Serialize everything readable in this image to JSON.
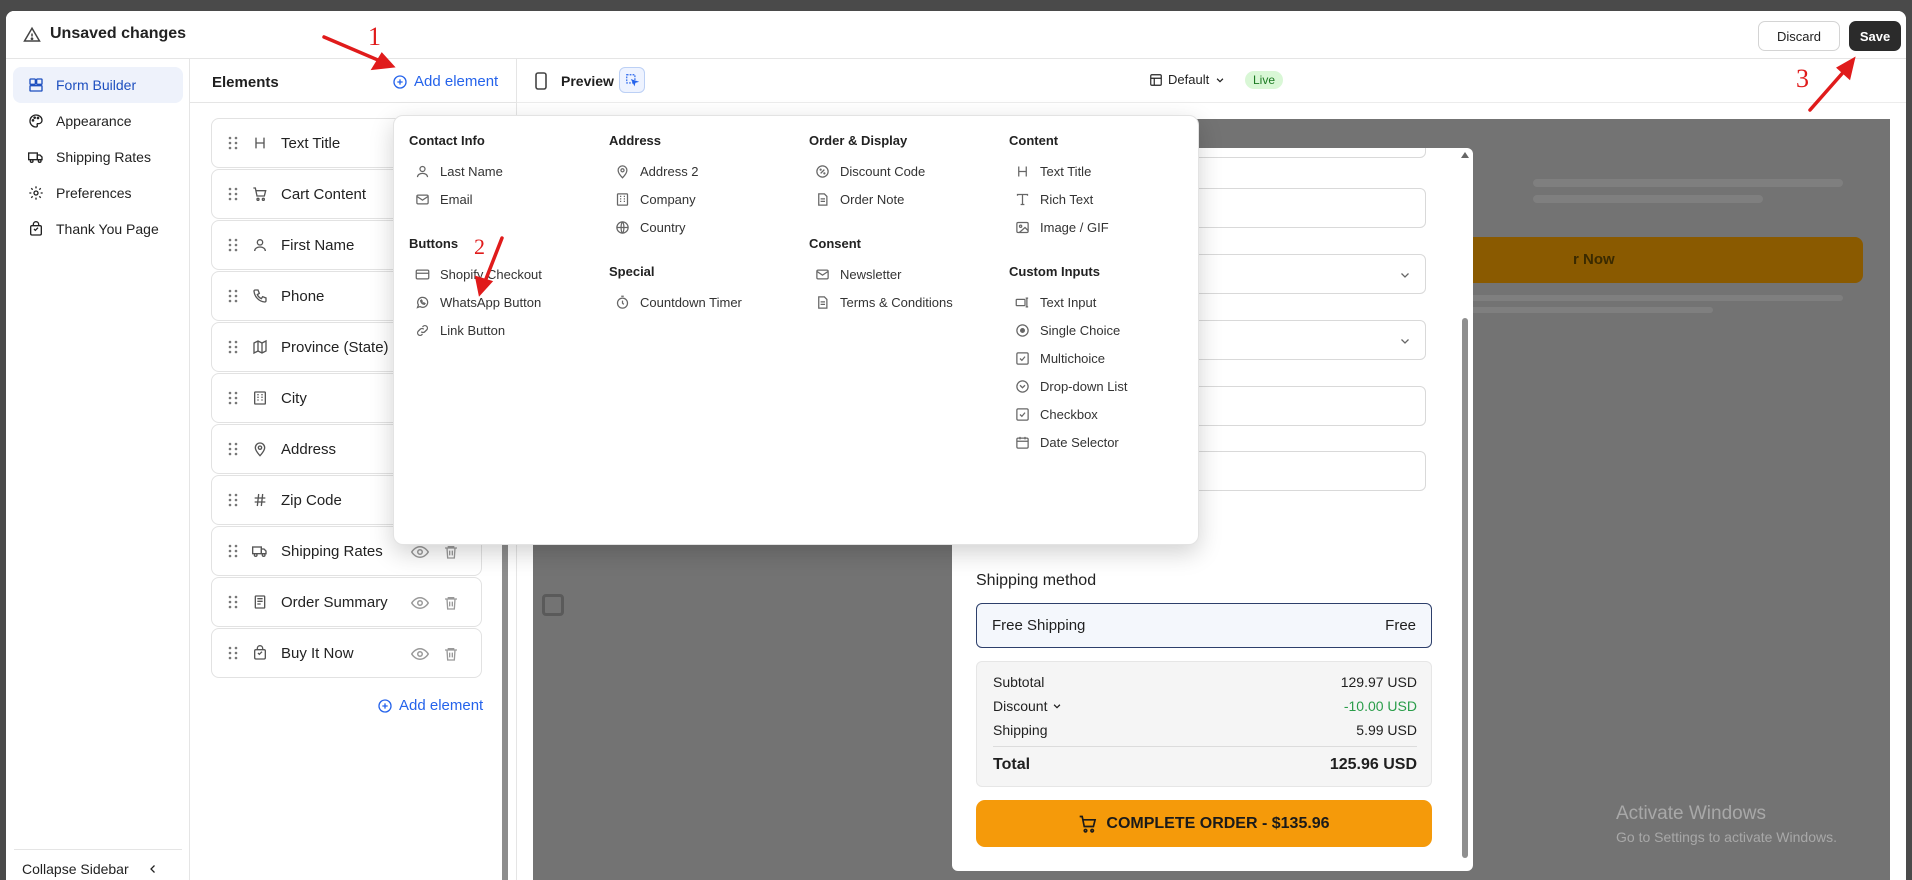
{
  "topbar": {
    "title": "Unsaved changes",
    "discard_label": "Discard",
    "save_label": "Save"
  },
  "sidebar": {
    "items": [
      {
        "label": "Form Builder",
        "icon": "layout-icon",
        "active": true
      },
      {
        "label": "Appearance",
        "icon": "palette-icon",
        "active": false
      },
      {
        "label": "Shipping Rates",
        "icon": "truck-icon",
        "active": false
      },
      {
        "label": "Preferences",
        "icon": "gear-icon",
        "active": false
      },
      {
        "label": "Thank You Page",
        "icon": "bag-icon",
        "active": false
      }
    ],
    "collapse_label": "Collapse Sidebar"
  },
  "elements": {
    "title": "Elements",
    "add_label": "Add element",
    "rows": [
      {
        "label": "Text Title",
        "icon": "heading-icon"
      },
      {
        "label": "Cart Content",
        "icon": "cart-icon"
      },
      {
        "label": "First Name",
        "icon": "user-icon"
      },
      {
        "label": "Phone",
        "icon": "phone-icon"
      },
      {
        "label": "Province (State)",
        "icon": "map-icon"
      },
      {
        "label": "City",
        "icon": "building-icon"
      },
      {
        "label": "Address",
        "icon": "pin-icon"
      },
      {
        "label": "Zip Code",
        "icon": "hash-icon"
      },
      {
        "label": "Shipping Rates",
        "icon": "truck-icon"
      },
      {
        "label": "Order Summary",
        "icon": "receipt-icon"
      },
      {
        "label": "Buy It Now",
        "icon": "bag-icon"
      }
    ],
    "add_bottom_label": "Add element"
  },
  "preview": {
    "label": "Preview",
    "variant": "Default",
    "status": "Live",
    "ghost_button": "r Now"
  },
  "checkout": {
    "shipping_title": "Shipping method",
    "shipping_option": {
      "name": "Free Shipping",
      "price": "Free"
    },
    "summary": {
      "subtotal_label": "Subtotal",
      "subtotal_value": "129.97 USD",
      "discount_label": "Discount",
      "discount_value": "-10.00 USD",
      "shipping_label": "Shipping",
      "shipping_value": "5.99 USD",
      "total_label": "Total",
      "total_value": "125.96 USD"
    },
    "complete_label": "COMPLETE ORDER - $135.96"
  },
  "menu": {
    "columns": [
      {
        "groups": [
          {
            "title": "Contact Info",
            "items": [
              {
                "label": "Last Name",
                "icon": "user-icon"
              },
              {
                "label": "Email",
                "icon": "mail-icon"
              }
            ]
          },
          {
            "title": "Buttons",
            "items": [
              {
                "label": "Shopify Checkout",
                "icon": "card-icon"
              },
              {
                "label": "WhatsApp Button",
                "icon": "whatsapp-icon"
              },
              {
                "label": "Link Button",
                "icon": "link-icon"
              }
            ]
          }
        ]
      },
      {
        "groups": [
          {
            "title": "Address",
            "items": [
              {
                "label": "Address 2",
                "icon": "pin-icon"
              },
              {
                "label": "Company",
                "icon": "building-icon"
              },
              {
                "label": "Country",
                "icon": "globe-icon"
              }
            ]
          },
          {
            "title": "Special",
            "items": [
              {
                "label": "Countdown Timer",
                "icon": "timer-icon"
              }
            ]
          }
        ]
      },
      {
        "groups": [
          {
            "title": "Order & Display",
            "items": [
              {
                "label": "Discount Code",
                "icon": "percent-icon"
              },
              {
                "label": "Order Note",
                "icon": "note-icon"
              }
            ]
          },
          {
            "title": "Consent",
            "items": [
              {
                "label": "Newsletter",
                "icon": "mail-icon"
              },
              {
                "label": "Terms & Conditions",
                "icon": "document-icon"
              }
            ]
          }
        ]
      },
      {
        "groups": [
          {
            "title": "Content",
            "items": [
              {
                "label": "Text Title",
                "icon": "heading-icon"
              },
              {
                "label": "Rich Text",
                "icon": "type-icon"
              },
              {
                "label": "Image / GIF",
                "icon": "image-icon"
              }
            ]
          },
          {
            "title": "Custom Inputs",
            "items": [
              {
                "label": "Text Input",
                "icon": "text-input-icon"
              },
              {
                "label": "Single Choice",
                "icon": "radio-icon"
              },
              {
                "label": "Multichoice",
                "icon": "checkbox-icon"
              },
              {
                "label": "Drop-down List",
                "icon": "dropdown-icon"
              },
              {
                "label": "Checkbox",
                "icon": "checkbox-icon"
              },
              {
                "label": "Date Selector",
                "icon": "calendar-icon"
              }
            ]
          }
        ]
      }
    ]
  },
  "watermark": {
    "line1": "Activate Windows",
    "line2": "Go to Settings to activate Windows."
  },
  "annotations": {
    "step1": "1",
    "step2": "2",
    "step3": "3"
  },
  "colors": {
    "accent": "#2563eb",
    "annotation": "#e01b1b",
    "cta": "#f59a0a",
    "discount": "#2a9d4a",
    "live_bg": "#d9f7d6"
  }
}
